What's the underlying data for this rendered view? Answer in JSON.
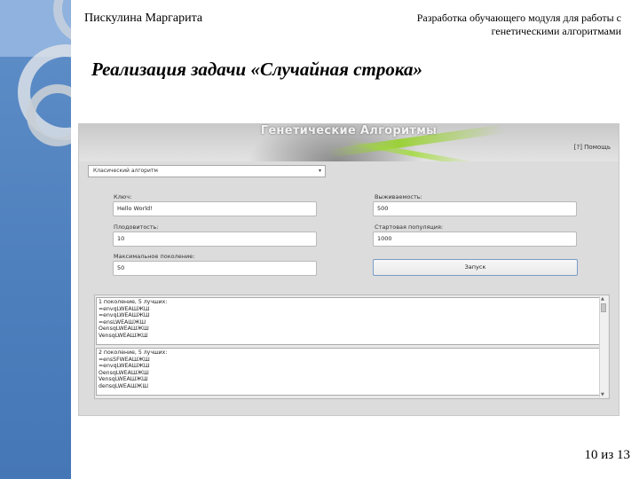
{
  "slide": {
    "author": "Пискулина Маргарита",
    "topic": "Разработка обучающего модуля для работы с генетическими алгоритмами",
    "title": "Реализация задачи «Случайная строка»",
    "page": "10 из 13"
  },
  "app": {
    "banner_title": "Генетические Алгоритмы",
    "help_link": "[?] Помощь",
    "algorithm_select": {
      "value": "Класический алгоритм",
      "arrow": "▾"
    },
    "fields": {
      "key": {
        "label": "Ключ:",
        "value": "Hello World!"
      },
      "survival": {
        "label": "Выживаемость:",
        "value": "500"
      },
      "fertility": {
        "label": "Плодовитость:",
        "value": "10"
      },
      "start_population": {
        "label": "Стартовая популяция:",
        "value": "1000"
      },
      "max_generation": {
        "label": "Максимальное поколение:",
        "value": "50"
      }
    },
    "run_button": "Запуск",
    "results": [
      {
        "header": "1 поколение, 5 лучших:",
        "lines": [
          "=envqLWEAШЖШ",
          "=envqLWEAШЖШ",
          "=ensLWEAШЖШ",
          "OensqLWEAШЖШ",
          "VensqLWEAШЖШ"
        ]
      },
      {
        "header": "2 поколение, 5 лучших:",
        "lines": [
          "=ensSFWEAШЖШ",
          "=envqLWEAШЖШ",
          "OensqLWEAШЖШ",
          "VensqLWEAШЖШ",
          "deпsqLWEAШЖШ"
        ]
      }
    ]
  },
  "colors": {
    "sidebar": "#4d7fbd",
    "accent_green": "#96d228",
    "run_button_border": "#7a9bc9"
  }
}
